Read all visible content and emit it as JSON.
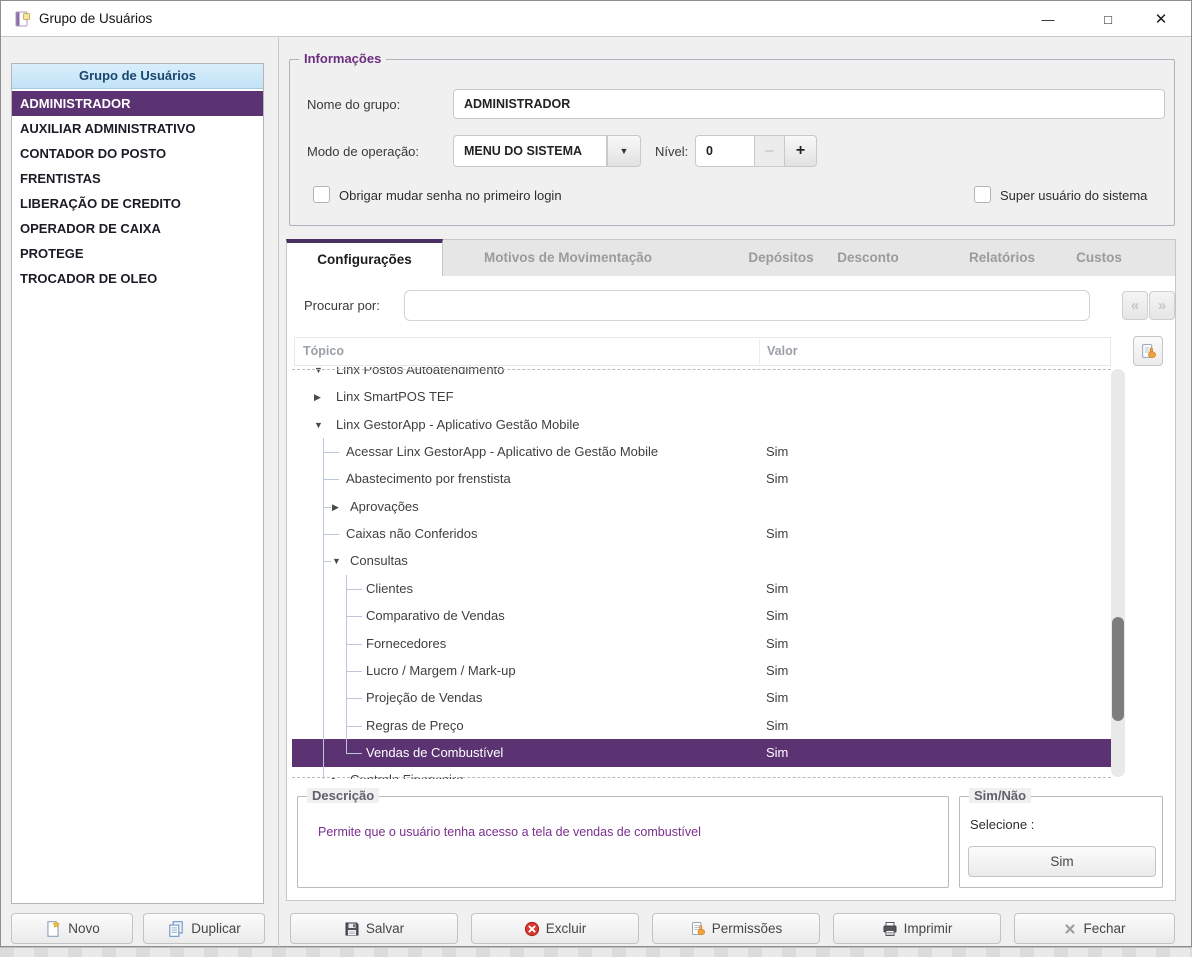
{
  "window": {
    "title": "Grupo de Usuários",
    "icon": "form-icon",
    "controls": [
      {
        "name": "minimize",
        "glyph": "—"
      },
      {
        "name": "maximize",
        "glyph": "□"
      },
      {
        "name": "close",
        "glyph": "✕"
      }
    ]
  },
  "left_panel": {
    "header": "Grupo de Usuários",
    "groups": [
      {
        "label": "ADMINISTRADOR",
        "selected": true
      },
      {
        "label": "AUXILIAR ADMINISTRATIVO"
      },
      {
        "label": "CONTADOR DO POSTO"
      },
      {
        "label": "FRENTISTAS"
      },
      {
        "label": "LIBERAÇÃO DE CREDITO"
      },
      {
        "label": "OPERADOR DE CAIXA"
      },
      {
        "label": "PROTEGE"
      },
      {
        "label": "TROCADOR DE OLEO"
      }
    ],
    "buttons": [
      {
        "label": "Novo",
        "icon": "new-icon"
      },
      {
        "label": "Duplicar",
        "icon": "duplicate-icon"
      }
    ]
  },
  "info": {
    "legend": "Informações",
    "nome_label": "Nome do grupo:",
    "nome_value": "ADMINISTRADOR",
    "modo_label": "Modo de operação:",
    "modo_value": "MENU DO SISTEMA",
    "dropdown_icon": "chevron-down-icon",
    "nivel_label": "Nível:",
    "nivel_value": "0",
    "minus_glyph": "–",
    "plus_glyph": "+",
    "force_password_label": "Obrigar mudar senha no primeiro login",
    "super_user_label": "Super usuário do sistema"
  },
  "tabs": [
    {
      "label": "Configurações",
      "active": true
    },
    {
      "label": "Motivos de Movimentação"
    },
    {
      "label": "Depósitos"
    },
    {
      "label": "Desconto"
    },
    {
      "label": "Relatórios"
    },
    {
      "label": "Custos"
    }
  ],
  "search": {
    "label": "Procurar por:",
    "value": "",
    "prev_icon": "chevrons-left-icon",
    "next_icon": "chevrons-right-icon"
  },
  "tree": {
    "columns": [
      "Tópico",
      "Valor"
    ],
    "hand_button_icon": "hand-permission-icon",
    "rows": [
      {
        "label": "Linx Postos Autoatendimento",
        "level": 0,
        "arrow": "down",
        "clipped": "top"
      },
      {
        "label": "Linx SmartPOS TEF",
        "level": 0,
        "arrow": "right"
      },
      {
        "label": "Linx GestorApp - Aplicativo Gestão Mobile",
        "level": 0,
        "arrow": "down"
      },
      {
        "label": "Acessar Linx GestorApp - Aplicativo de Gestão Mobile",
        "level": 1,
        "value": "Sim"
      },
      {
        "label": "Abastecimento por frenstista",
        "level": 1,
        "value": "Sim"
      },
      {
        "label": "Aprovações",
        "level": 1,
        "arrow": "right"
      },
      {
        "label": "Caixas não Conferidos",
        "level": 1,
        "value": "Sim"
      },
      {
        "label": "Consultas",
        "level": 1,
        "arrow": "down"
      },
      {
        "label": "Clientes",
        "level": 2,
        "value": "Sim"
      },
      {
        "label": "Comparativo de Vendas",
        "level": 2,
        "value": "Sim"
      },
      {
        "label": "Fornecedores",
        "level": 2,
        "value": "Sim"
      },
      {
        "label": "Lucro / Margem / Mark-up",
        "level": 2,
        "value": "Sim"
      },
      {
        "label": "Projeção de Vendas",
        "level": 2,
        "value": "Sim"
      },
      {
        "label": "Regras de Preço",
        "level": 2,
        "value": "Sim"
      },
      {
        "label": "Vendas de Combustível",
        "level": 2,
        "value": "Sim",
        "selected": true
      },
      {
        "label": "Controle Financeiro",
        "level": 1,
        "arrow": "right",
        "clipped": "bottom"
      }
    ]
  },
  "descricao": {
    "legend": "Descrição",
    "text": "Permite que o usuário tenha acesso a tela de vendas de combustível"
  },
  "sim_nao": {
    "legend": "Sim/Não",
    "label": "Selecione :",
    "button_label": "Sim"
  },
  "footer_buttons": [
    {
      "label": "Salvar",
      "icon": "save-icon"
    },
    {
      "label": "Excluir",
      "icon": "delete-icon"
    },
    {
      "label": "Permissões",
      "icon": "permissions-icon"
    },
    {
      "label": "Imprimir",
      "icon": "print-icon"
    },
    {
      "label": "Fechar",
      "icon": "close-icon"
    }
  ],
  "colors": {
    "selection_purple": "#5b3272",
    "tab_accent_purple": "#4a2f63",
    "legend_purple": "#6d2d7f",
    "description_text_purple": "#7b2f8e",
    "list_header_blue": "#17466e"
  }
}
